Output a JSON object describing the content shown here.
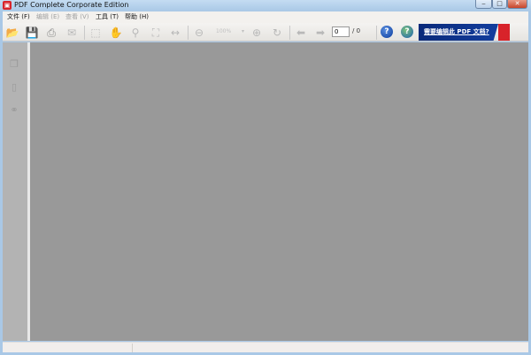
{
  "window": {
    "title": "PDF Complete Corporate Edition",
    "minimize": "‒",
    "maximize": "□",
    "close": "✕"
  },
  "menu": [
    {
      "label": "文件 (F)",
      "enabled": true
    },
    {
      "label": "编辑 (E)",
      "enabled": false
    },
    {
      "label": "查看 (V)",
      "enabled": false
    },
    {
      "label": "工具 (T)",
      "enabled": true
    },
    {
      "label": "帮助 (H)",
      "enabled": true
    }
  ],
  "toolbar": {
    "zoom_value": "100%",
    "page_value": "0",
    "page_total": "/ 0",
    "help": "?",
    "banner_text": "需要编辑此 PDF 文档?"
  },
  "colors": {
    "accent": "#d8232a",
    "banner": "#0a2a7a",
    "canvas": "#999999"
  }
}
